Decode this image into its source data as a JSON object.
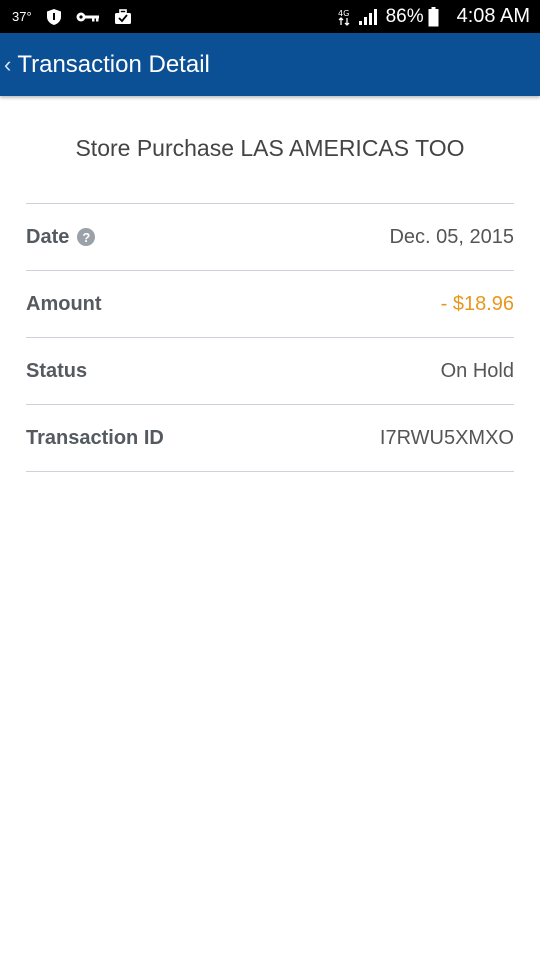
{
  "status_bar": {
    "temperature": "37°",
    "icons": [
      "shield-icon",
      "key-icon",
      "briefcase-icon",
      "data-transfer-icon",
      "signal-icon",
      "battery-icon"
    ],
    "battery_percent": "86%",
    "time": "4:08 AM"
  },
  "app_bar": {
    "back_icon": "‹",
    "title": "Transaction Detail",
    "color": "#0b4f94"
  },
  "transaction": {
    "merchant": "Store Purchase LAS AMERICAS TOO",
    "rows": [
      {
        "label": "Date",
        "value": "Dec. 05, 2015",
        "help_icon": "?"
      },
      {
        "label": "Amount",
        "value": "- $18.96",
        "value_color": "#e8971e"
      },
      {
        "label": "Status",
        "value": "On Hold"
      },
      {
        "label": "Transaction ID",
        "value": "I7RWU5XMXO"
      }
    ]
  }
}
